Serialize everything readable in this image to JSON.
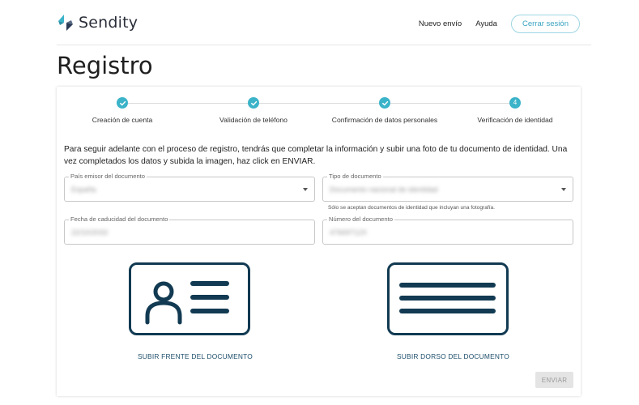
{
  "brand": {
    "name": "Sendity",
    "colors": {
      "primary": "#3bb3c9",
      "dark": "#123a52",
      "link": "#1d4e6b"
    }
  },
  "nav": {
    "links": [
      "Nuevo envío",
      "Ayuda"
    ],
    "logout_label": "Cerrar sesión"
  },
  "page": {
    "title": "Registro"
  },
  "stepper": {
    "steps": [
      {
        "label": "Creación de cuenta",
        "state": "done",
        "marker": "check-icon"
      },
      {
        "label": "Validación de teléfono",
        "state": "done",
        "marker": "check-icon"
      },
      {
        "label": "Confirmación de datos personales",
        "state": "done",
        "marker": "check-icon"
      },
      {
        "label": "Verificación de identidad",
        "state": "active",
        "number": "4"
      }
    ]
  },
  "form": {
    "intro": "Para seguir adelante con el proceso de registro, tendrás que completar la información y subir una foto de tu documento de identidad. Una vez completados los datos y subida la imagen, haz click en ENVIAR.",
    "issuing_country": {
      "label": "País emisor del documento",
      "value": "España"
    },
    "document_type": {
      "label": "Tipo de documento",
      "value": "Documento nacional de identidad",
      "helper": "Sólo se aceptan documentos de identidad que incluyan una fotografía."
    },
    "expiry_date": {
      "label": "Fecha de caducidad del documento",
      "value": "22/10/2033"
    },
    "document_number": {
      "label": "Número del documento",
      "value": "47669712X"
    },
    "upload_front_label": "SUBIR FRENTE DEL DOCUMENTO",
    "upload_back_label": "SUBIR DORSO DEL DOCUMENTO",
    "submit_label": "ENVIAR",
    "submit_enabled": false
  }
}
